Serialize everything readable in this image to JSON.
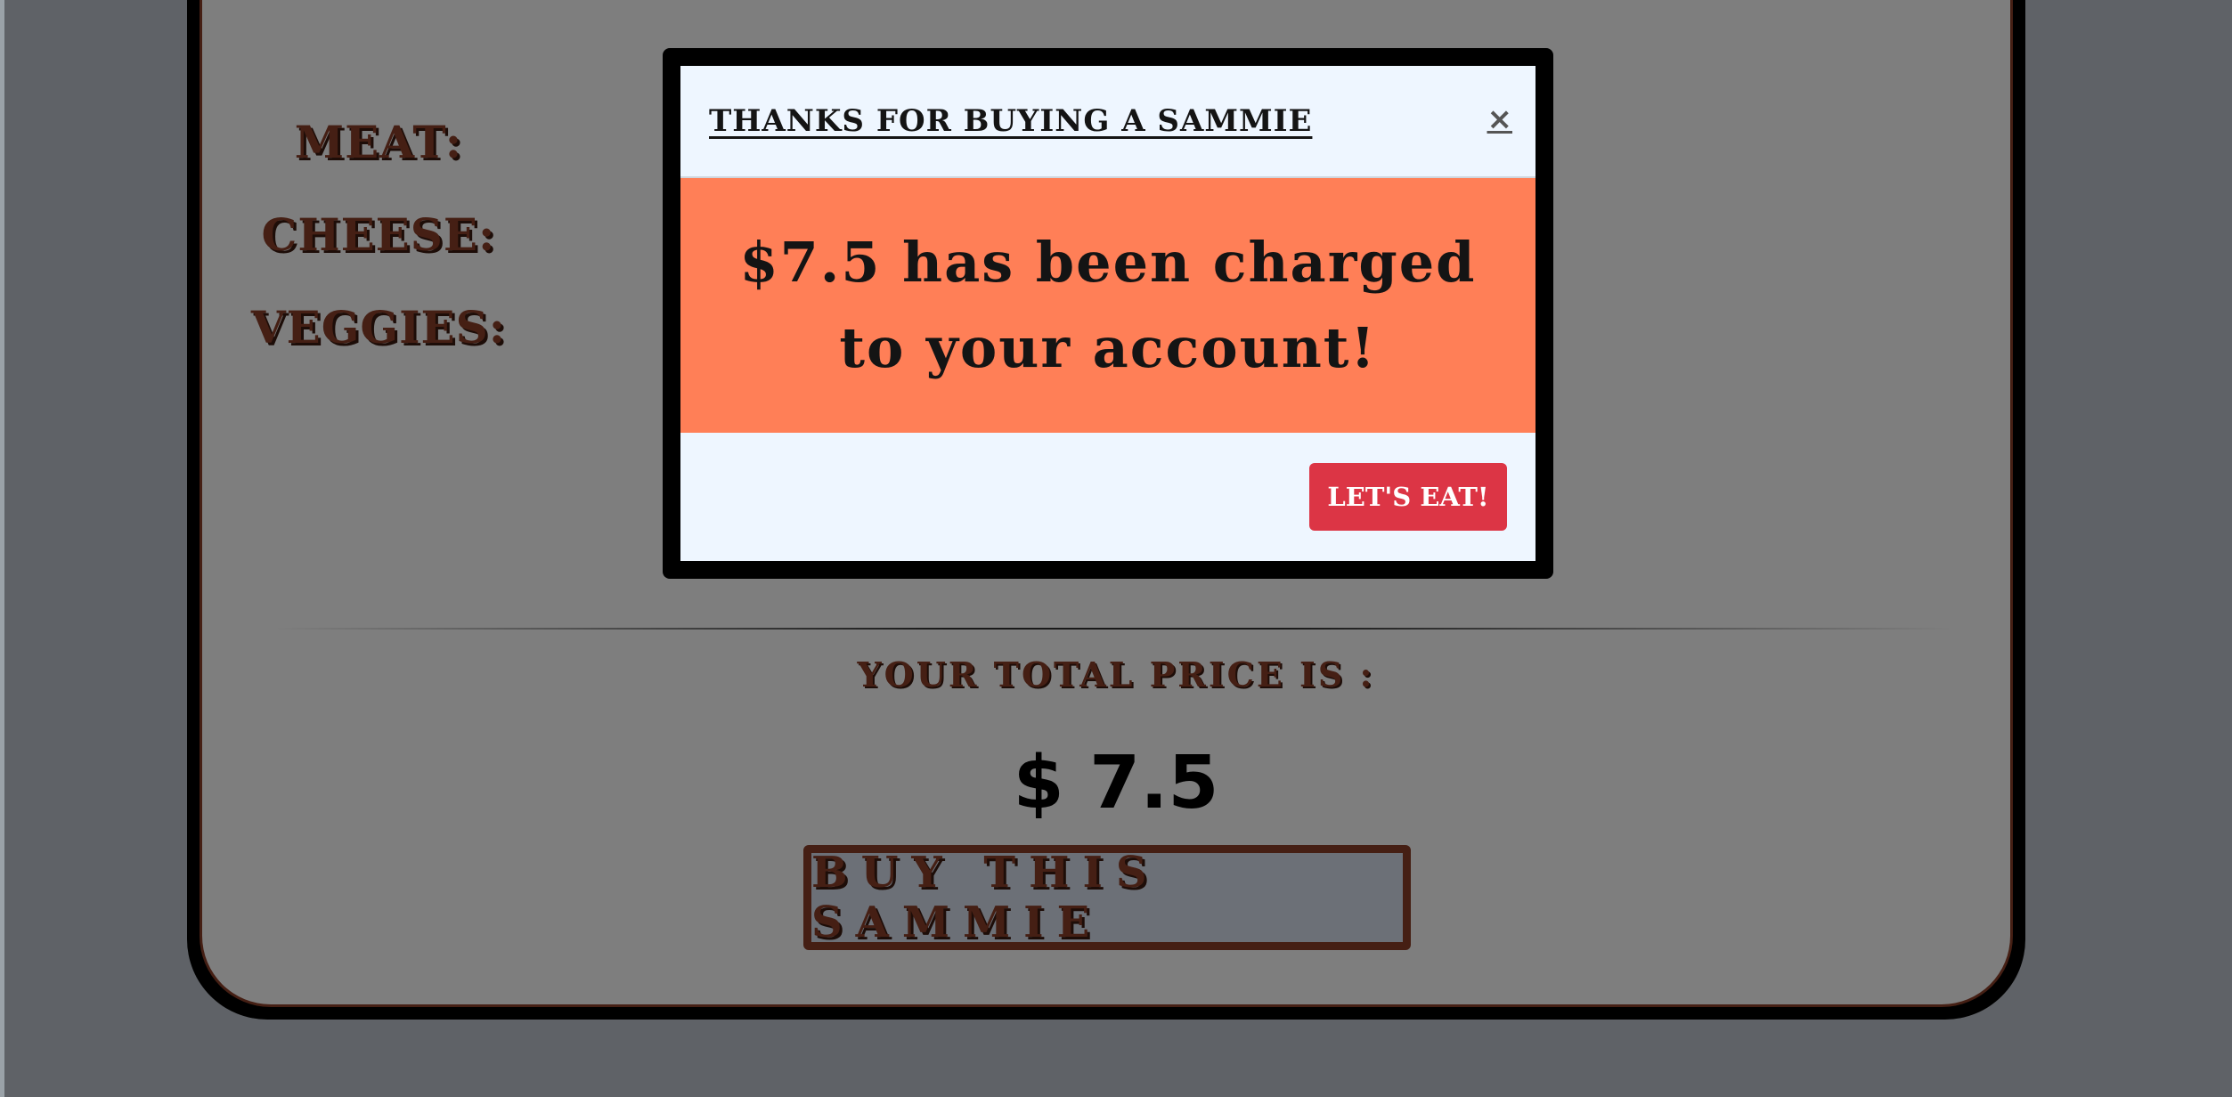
{
  "page": {
    "ingredients": {
      "meat_label": "MEAT:",
      "cheese_label": "CHEESE:",
      "veggies_label": "VEGGIES:"
    },
    "total": {
      "label": "YOUR TOTAL PRICE IS :",
      "price": "$ 7.5"
    },
    "buy_button_label": "BUY THIS SAMMIE"
  },
  "modal": {
    "title": "THANKS FOR BUYING A SAMMIE",
    "close_symbol": "×",
    "message": "$7.5 has been charged to your account!",
    "action_label": "LET'S EAT!"
  },
  "colors": {
    "accent_brown": "#8b3e28",
    "modal_body": "#ff7f57",
    "modal_button": "#dc3545",
    "modal_background": "#eef6ff",
    "backdrop": "rgba(0,0,0,0.5)"
  }
}
